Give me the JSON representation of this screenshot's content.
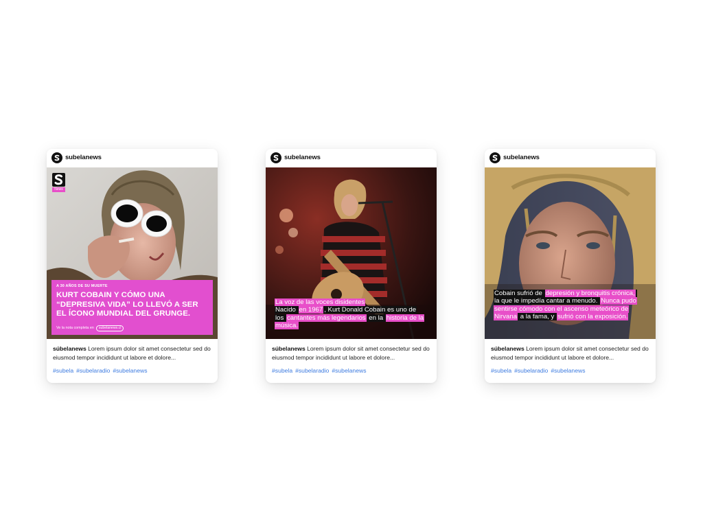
{
  "posts": [
    {
      "username": "subelanews",
      "logo_news_label": "News",
      "kicker": "A 30 AÑOS DE SU MUERTE",
      "title": "KURT COBAIN Y CÓMO UNA “DEPRESIVA VIDA” LO LLEVÓ A SER EL ÍCONO MUNDIAL DEL GRUNGE.",
      "footer_text": "Ve la nota completa en",
      "footer_link": "subelanews.cl",
      "caption_user": "súbelanews",
      "caption_text": "Lorem ipsum dolor sit amet consectetur sed do eiusmod tempor incididunt ut labore et dolore...",
      "tags": [
        "#subela",
        "#subelaradio",
        "#subelanews"
      ]
    },
    {
      "username": "subelanews",
      "overlay": [
        {
          "text": "La voz de las voces disidentes",
          "style": "pink"
        },
        {
          "text": "Nacido ",
          "style": "black"
        },
        {
          "text": "en 1967",
          "style": "pink"
        },
        {
          "text": ", Kurt Donald Cobain es uno de los ",
          "style": "black"
        },
        {
          "text": "cantantes más legendarios",
          "style": "pink"
        },
        {
          "text": " en la ",
          "style": "black"
        },
        {
          "text": "historia de la música.",
          "style": "pink"
        }
      ],
      "caption_user": "súbelanews",
      "caption_text": "Lorem ipsum dolor sit amet consectetur sed do eiusmod tempor incididunt ut labore et dolore...",
      "tags": [
        "#subela",
        "#subelaradio",
        "#subelanews"
      ]
    },
    {
      "username": "subelanews",
      "overlay": [
        {
          "text": "Cobain sufrió de ",
          "style": "black"
        },
        {
          "text": "depresión y bronquitis crónica,",
          "style": "pink"
        },
        {
          "text": " la que le impedía cantar a menudo. ",
          "style": "black"
        },
        {
          "text": "Nunca pudo sentirse cómodo con el ascenso meteórico de Nirvana",
          "style": "pink"
        },
        {
          "text": " a la fama, y ",
          "style": "black"
        },
        {
          "text": "sufrió con la exposición.",
          "style": "pink"
        }
      ],
      "caption_user": "súbelanews",
      "caption_text": "Lorem ipsum dolor sit amet consectetur sed do eiusmod tempor incididunt ut labore et dolore...",
      "tags": [
        "#subela",
        "#subelaradio",
        "#subelanews"
      ]
    }
  ],
  "colors": {
    "accent_pink": "#e24fcf",
    "hashtag_blue": "#3d7be0",
    "highlight_black": "#111111"
  },
  "icons": {
    "avatar": "subela-logo-icon"
  }
}
